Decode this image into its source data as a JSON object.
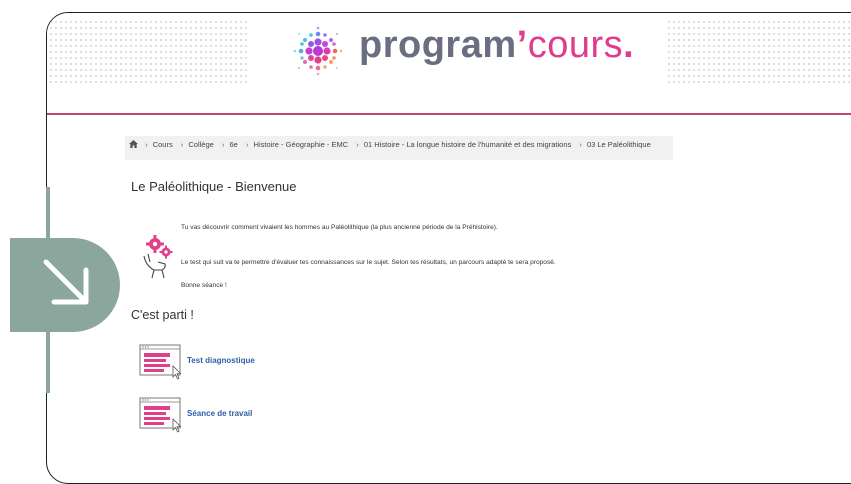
{
  "logo": {
    "word_part1": "program",
    "apostrophe": "’",
    "word_part2": "cours",
    "dot": ".",
    "accent_color": "#e03b8c",
    "text_color": "#6b6e80"
  },
  "breadcrumb": {
    "home_icon": "home-icon",
    "items": [
      "Cours",
      "Collège",
      "6e",
      "Histoire - Géographie - EMC",
      "01 Histoire - La longue histoire de l'humanité et des migrations",
      "03 Le Paléolithique"
    ],
    "separator": "›"
  },
  "page": {
    "title": "Le Paléolithique - Bienvenue",
    "intro_line1": "Tu vas découvrir comment vivaient les hommes au Paléolithique (la plus ancienne période de la Préhistoire).",
    "intro_line2": "Le test qui suit va te permettre d'évaluer tes connaissances sur le sujet. Selon tes résultats, un parcours adapté te sera proposé.",
    "intro_line3": "Bonne séance !",
    "section_title": "C'est parti !"
  },
  "activities": [
    {
      "label": "Test diagnostique",
      "icon": "page-activity-icon"
    },
    {
      "label": "Séance de travail",
      "icon": "page-activity-icon"
    }
  ],
  "colors": {
    "header_line": "#c9447a",
    "link": "#2e5fa8",
    "teal": "#8ba69d"
  }
}
